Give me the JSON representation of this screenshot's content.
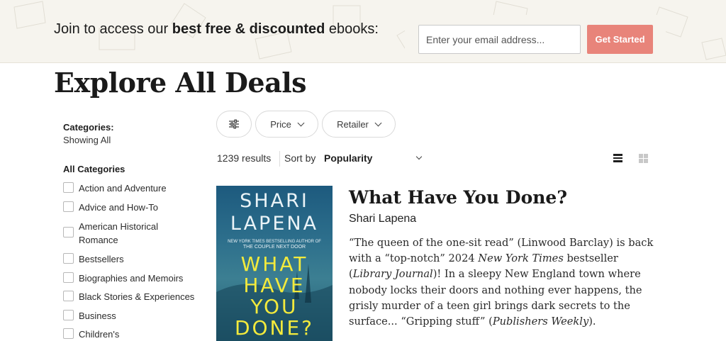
{
  "banner": {
    "text_prefix": "Join to access our ",
    "text_bold": "best free & discounted",
    "text_suffix": " ebooks:",
    "email_placeholder": "Enter your email address...",
    "cta_label": "Get Started",
    "cta_color": "#e8847a"
  },
  "page": {
    "title": "Explore All Deals"
  },
  "sidebar": {
    "categories_heading": "Categories:",
    "showing": "Showing All",
    "all_categories": "All Categories",
    "items": [
      {
        "label": "Action and Adventure"
      },
      {
        "label": "Advice and How-To"
      },
      {
        "label": "American Historical Romance"
      },
      {
        "label": "Bestsellers"
      },
      {
        "label": "Biographies and Memoirs"
      },
      {
        "label": "Black Stories & Experiences"
      },
      {
        "label": "Business"
      },
      {
        "label": "Children's"
      }
    ]
  },
  "filters": {
    "settings_icon": "sliders-icon",
    "price_label": "Price",
    "retailer_label": "Retailer"
  },
  "results": {
    "count": "1239 results",
    "sort_label": "Sort by",
    "sort_value": "Popularity",
    "view_list_icon": "list-view-icon",
    "view_grid_icon": "grid-view-icon"
  },
  "book": {
    "title": "What Have You Done?",
    "author": "Shari Lapena",
    "cover": {
      "author_line1": "SHARI",
      "author_line2": "LAPENA",
      "tagline_line1": "NEW YORK TIMES BESTSELLING AUTHOR OF",
      "tagline_line2": "THE COUPLE NEXT DOOR",
      "title_line1": "WHAT",
      "title_line2": "HAVE",
      "title_line3": "YOU",
      "title_line4": "DONE?"
    },
    "desc": {
      "p1": "“The queen of the one-sit read” (Linwood Barclay) is back with a “top-notch” 2024 ",
      "i1": "New York Times",
      "p2": " bestseller (",
      "i2": "Library Journal",
      "p3": ")! In a sleepy New England town where nobody locks their doors and nothing ever happens, the grisly murder of a teen girl brings dark secrets to the surface... “Gripping stuff” (",
      "i3": "Publishers Weekly",
      "p4": ")."
    }
  }
}
